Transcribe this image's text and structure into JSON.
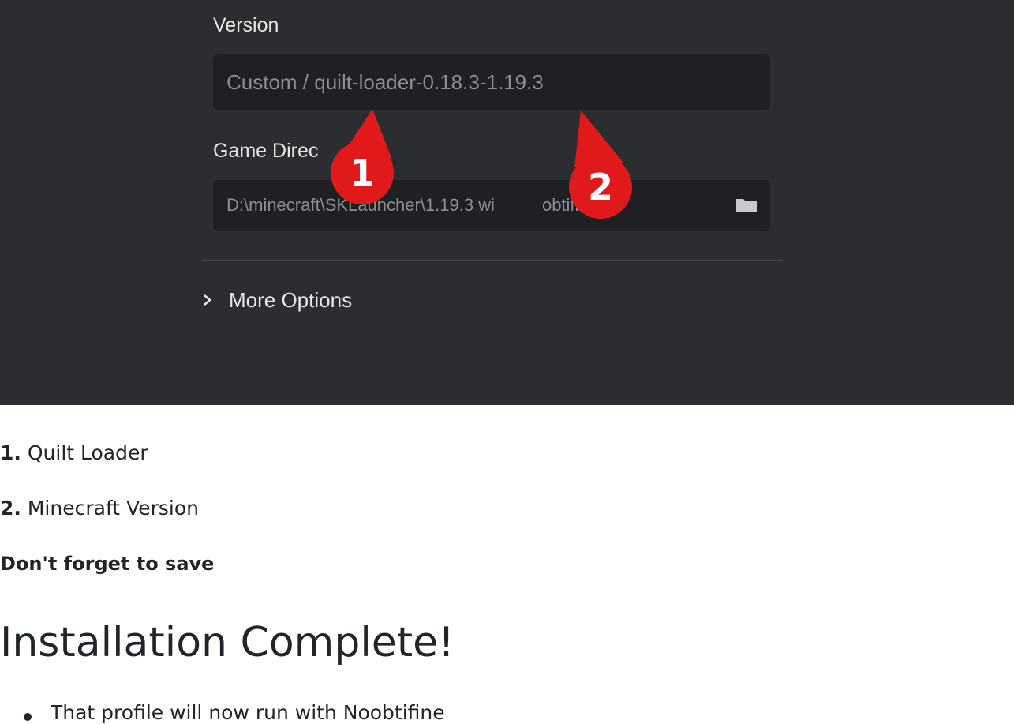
{
  "launcher": {
    "version_label": "Version",
    "version_value": "Custom / quilt-loader-0.18.3-1.19.3",
    "game_directory_label": "Game Direc",
    "game_directory_value": "D:\\minecraft\\SKLauncher\\1.19.3 wi",
    "game_directory_tail": "obtifine",
    "more_options_label": "More Options",
    "icons": {
      "folder": "folder-icon",
      "chevron": "chevron-right-icon"
    },
    "markers": [
      {
        "number": "1",
        "color": "#e01a1a"
      },
      {
        "number": "2",
        "color": "#e01a1a"
      }
    ],
    "colors": {
      "panel_bg": "#2b2d31",
      "input_bg": "#1e2024",
      "marker_red": "#e01a1a"
    }
  },
  "article": {
    "steps": [
      {
        "num": "1.",
        "text": " Quilt Loader"
      },
      {
        "num": "2.",
        "text": " Minecraft Version"
      }
    ],
    "save_note": "Don't forget to save",
    "heading": "Installation Complete!",
    "bullets": [
      "That profile will now run with Noobtifine"
    ]
  }
}
